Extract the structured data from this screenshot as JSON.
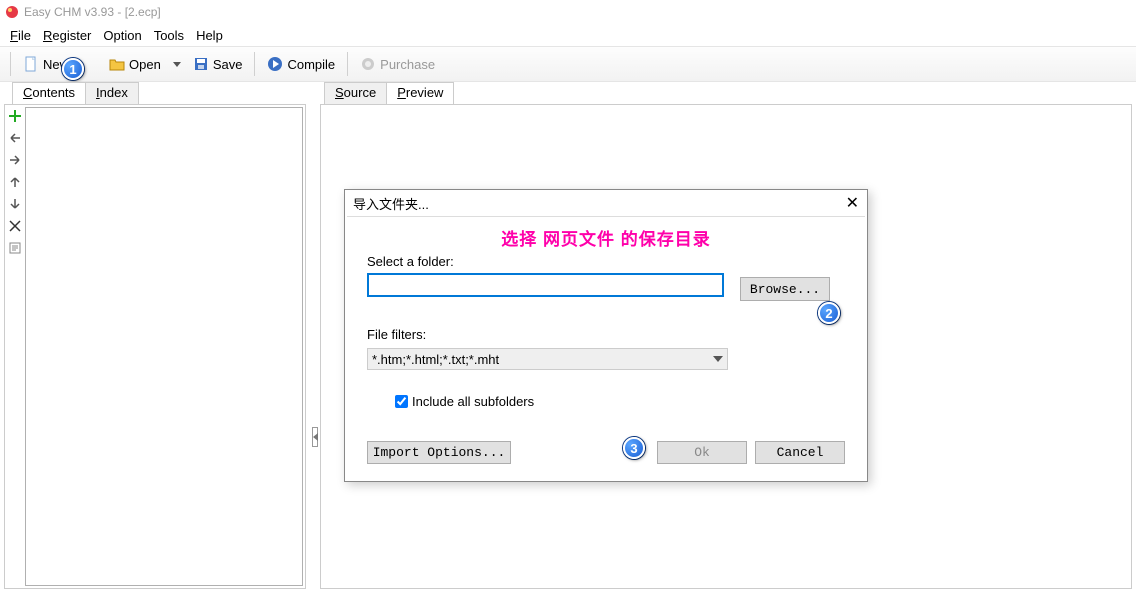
{
  "title": "Easy CHM v3.93 - [2.ecp]",
  "menu": {
    "file": "File",
    "register": "Register",
    "option": "Option",
    "tools": "Tools",
    "help": "Help"
  },
  "toolbar": {
    "new": "New",
    "open": "Open",
    "save": "Save",
    "compile": "Compile",
    "purchase": "Purchase"
  },
  "left_tabs": {
    "contents": "Contents",
    "index": "Index"
  },
  "right_tabs": {
    "source": "Source",
    "preview": "Preview"
  },
  "dialog": {
    "title": "导入文件夹...",
    "annotation": "选择 网页文件 的保存目录",
    "select_folder_label": "Select a folder:",
    "folder_value": "",
    "browse": "Browse...",
    "file_filters_label": "File filters:",
    "filters_value": "*.htm;*.html;*.txt;*.mht",
    "include_subfolders_checked": true,
    "include_subfolders_label": "Include all subfolders",
    "import_options": "Import Options...",
    "ok": "Ok",
    "cancel": "Cancel"
  },
  "callouts": {
    "c1": "1",
    "c2": "2",
    "c3": "3"
  }
}
